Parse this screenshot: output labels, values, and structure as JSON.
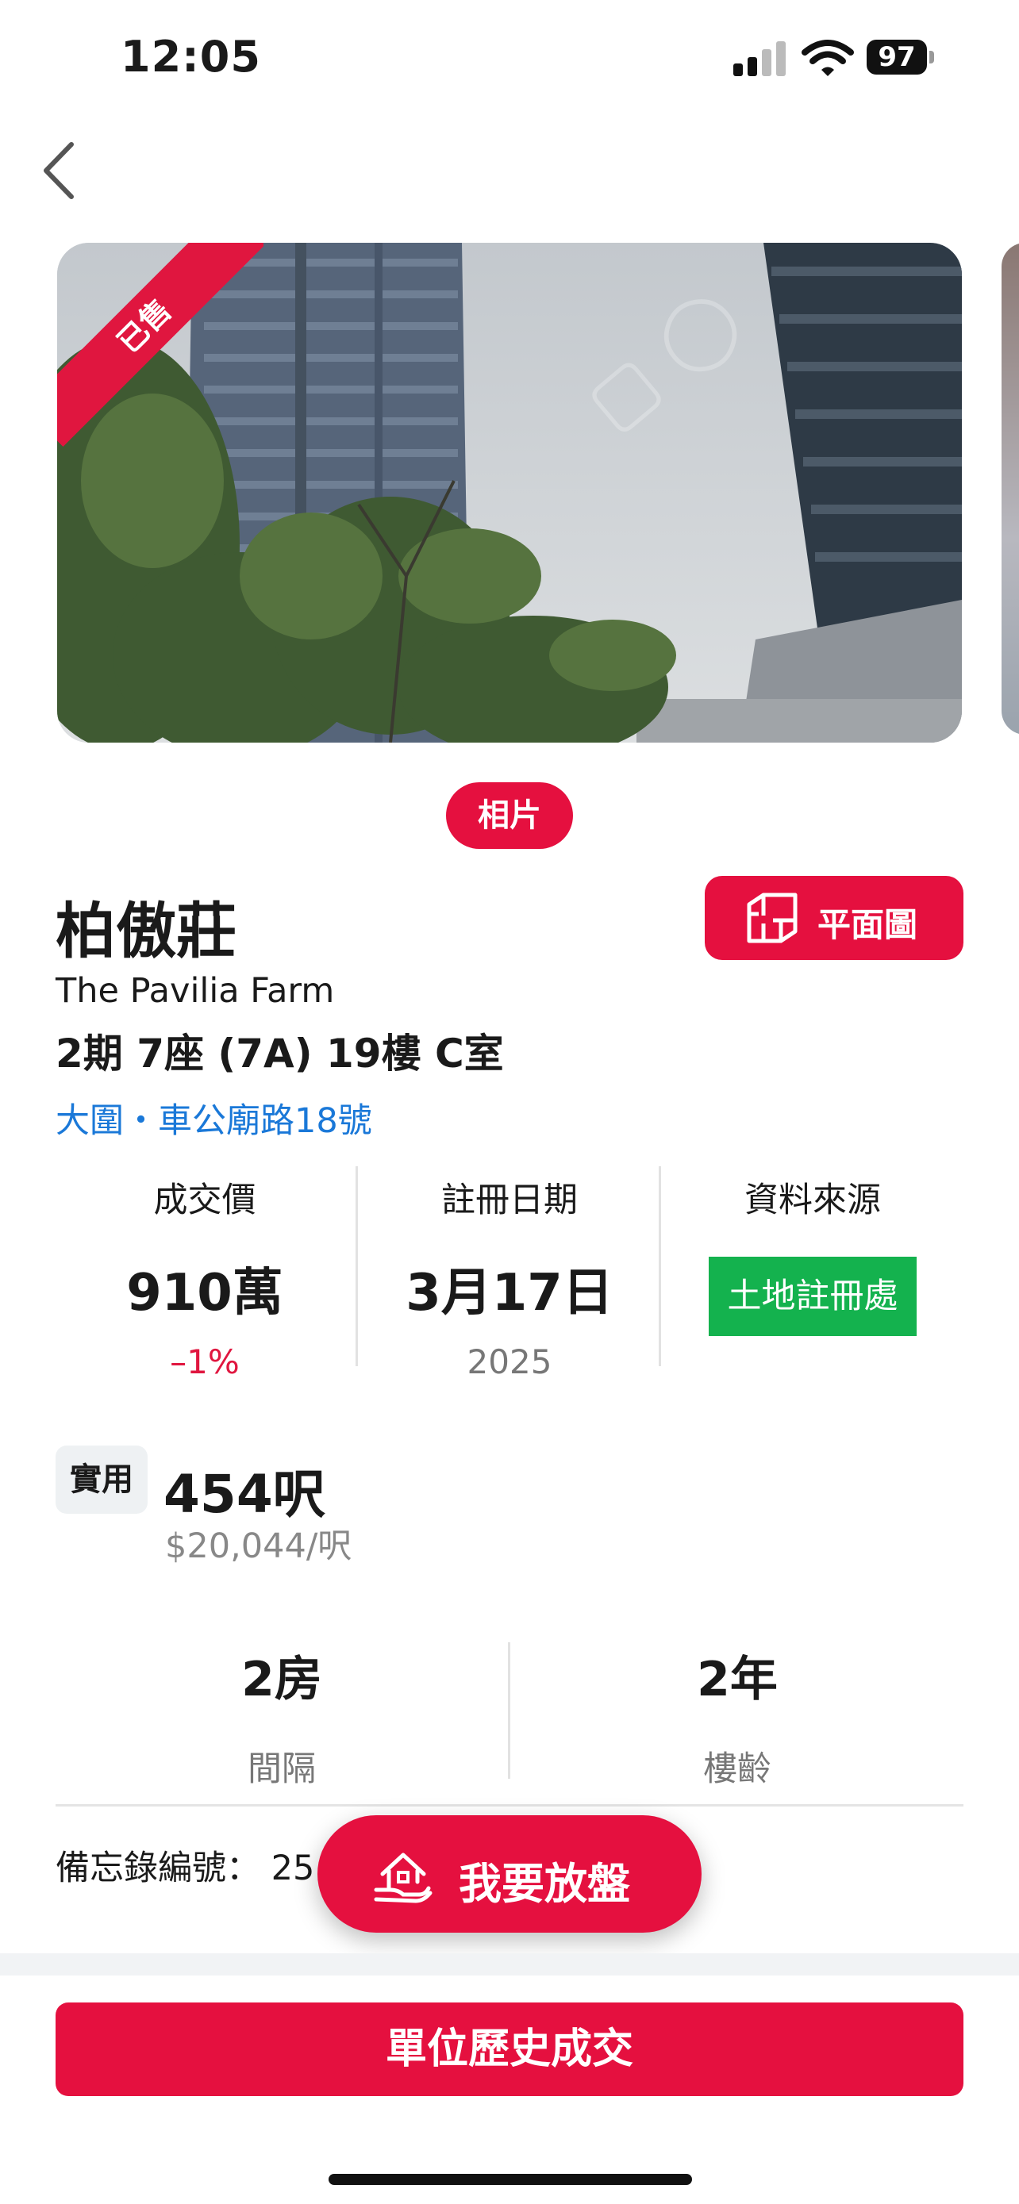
{
  "status_bar": {
    "time": "12:05",
    "battery": "97"
  },
  "hero": {
    "sold_label": "已售",
    "photos_label": "相片"
  },
  "property": {
    "name_zh": "柏傲莊",
    "name_en": "The Pavilia Farm",
    "unit": "2期 7座 (7A) 19樓 C室",
    "address": "大圍・車公廟路18號",
    "floorplan_label": "平面圖"
  },
  "stats": {
    "price": {
      "label": "成交價",
      "value": "910萬",
      "change": "–1%"
    },
    "date": {
      "label": "註冊日期",
      "value": "3月17日",
      "year": "2025"
    },
    "source": {
      "label": "資料來源",
      "value": "土地註冊處"
    }
  },
  "size": {
    "tag": "實用",
    "value": "454呎",
    "price_per_ft": "$20,044/呎"
  },
  "layout": {
    "rooms_value": "2房",
    "rooms_label": "間隔",
    "age_value": "2年",
    "age_label": "樓齡"
  },
  "memo": {
    "label": "備忘錄編號：",
    "value": "25"
  },
  "actions": {
    "list_property": "我要放盤",
    "unit_history": "單位歷史成交"
  },
  "colors": {
    "accent": "#e5103f",
    "link": "#1a78d8",
    "source_badge": "#14b24e",
    "down_change": "#e0163f"
  }
}
